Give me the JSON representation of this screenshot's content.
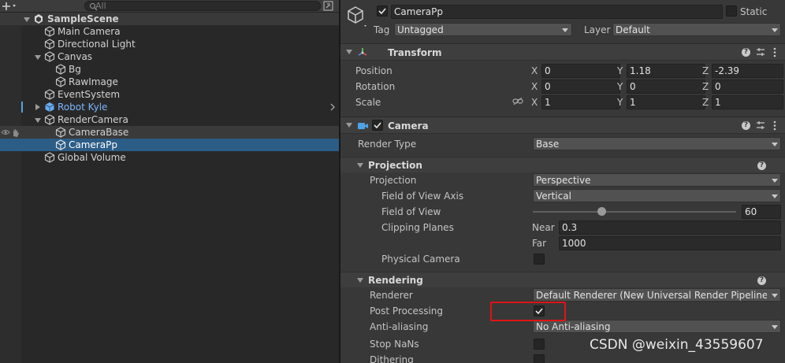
{
  "hierarchy": {
    "search_placeholder": "All",
    "rows": [
      {
        "label": "SampleScene"
      },
      {
        "label": "Main Camera"
      },
      {
        "label": "Directional Light"
      },
      {
        "label": "Canvas"
      },
      {
        "label": "Bg"
      },
      {
        "label": "RawImage"
      },
      {
        "label": "EventSystem"
      },
      {
        "label": "Robot Kyle"
      },
      {
        "label": "RenderCamera"
      },
      {
        "label": "CameraBase"
      },
      {
        "label": "CameraPp"
      },
      {
        "label": "Global Volume"
      }
    ]
  },
  "inspector": {
    "object_name": "CameraPp",
    "static_label": "Static",
    "tag_label": "Tag",
    "tag_value": "Untagged",
    "layer_label": "Layer",
    "layer_value": "Default",
    "transform": {
      "title": "Transform",
      "position_label": "Position",
      "rotation_label": "Rotation",
      "scale_label": "Scale",
      "x_label": "X",
      "y_label": "Y",
      "z_label": "Z",
      "position": {
        "x": "0",
        "y": "1.18",
        "z": "-2.39"
      },
      "rotation": {
        "x": "0",
        "y": "0",
        "z": "0"
      },
      "scale": {
        "x": "1",
        "y": "1",
        "z": "1"
      }
    },
    "camera": {
      "title": "Camera",
      "render_type_label": "Render Type",
      "render_type_value": "Base",
      "projection_section": "Projection",
      "projection_label": "Projection",
      "projection_value": "Perspective",
      "fov_axis_label": "Field of View Axis",
      "fov_axis_value": "Vertical",
      "fov_label": "Field of View",
      "fov_value": "60",
      "fov_slider_fraction": 0.339,
      "clipping_label": "Clipping Planes",
      "near_label": "Near",
      "near_value": "0.3",
      "far_label": "Far",
      "far_value": "1000",
      "physical_camera_label": "Physical Camera",
      "rendering_section": "Rendering",
      "renderer_label": "Renderer",
      "renderer_value": "Default Renderer (New Universal Render Pipeline Ass",
      "post_processing_label": "Post Processing",
      "antialiasing_label": "Anti-aliasing",
      "antialiasing_value": "No Anti-aliasing",
      "stop_nans_label": "Stop NaNs",
      "dithering_label": "Dithering"
    }
  },
  "watermark": "CSDN @weixin_43559607",
  "colors": {
    "selection": "#2c5d87",
    "prefab_text": "#7ab6ff",
    "highlight_box": "#e01414"
  }
}
